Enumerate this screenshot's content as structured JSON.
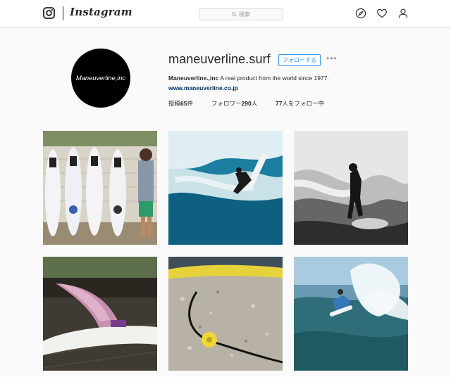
{
  "nav": {
    "brand": "Instagram",
    "search_placeholder": "検索",
    "icons": [
      "instagram-glyph-icon",
      "search-icon",
      "compass-icon",
      "heart-icon",
      "user-icon"
    ]
  },
  "profile": {
    "avatar_text": "Maneuverline,inc",
    "username": "maneuverline.surf",
    "follow_label": "フォローする",
    "more_label": "•••",
    "bio_name": "Maneuverline.,inc",
    "bio_text": " A real product from the world since 1977.",
    "website": "www.maneuverline.co.jp",
    "posts_prefix": "投稿",
    "posts_count": "65",
    "posts_suffix": "件",
    "followers_prefix": "フォロワー",
    "followers_count": "290",
    "followers_suffix": "人",
    "following_count": "77",
    "following_suffix": "人をフォロー中"
  },
  "colors": {
    "accent": "#3897f0",
    "link": "#003569",
    "border": "#dbdbdb",
    "background": "#fafafa"
  },
  "posts": [
    {
      "name": "surfboards-photo"
    },
    {
      "name": "surfer-wave-photo"
    },
    {
      "name": "bw-surfer-photo"
    },
    {
      "name": "fin-photo"
    },
    {
      "name": "leash-photo"
    },
    {
      "name": "surfer-spray-photo"
    }
  ]
}
